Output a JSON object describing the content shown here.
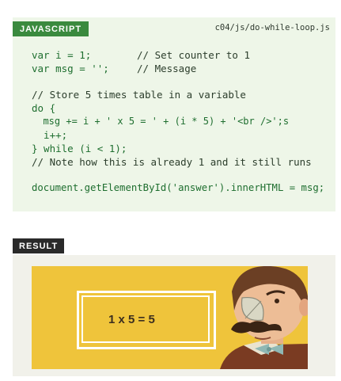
{
  "javascript": {
    "tag": "JAVASCRIPT",
    "file": "c04/js/do-while-loop.js",
    "lines": [
      "var i = 1;",
      "// Set counter to 1",
      "var msg = '';",
      "// Message",
      "// Store 5 times table in a variable",
      "do {",
      "  msg += i + ' x 5 = ' + (i * 5) + '<br />';s",
      "  i++;",
      "} while (i < 1);",
      "// Note how this is already 1 and it still runs",
      "document.getElementById('answer').innerHTML = msg;"
    ]
  },
  "result": {
    "tag": "RESULT",
    "answer": "1 x 5 = 5"
  },
  "colors": {
    "code_background": "#eef6e8",
    "code_text": "#1e6e2f",
    "js_tag": "#3a8a3e",
    "result_tag": "#2a2a2a",
    "panel_yellow": "#efc43b"
  },
  "icons": [
    "mustached-man-illustration"
  ]
}
